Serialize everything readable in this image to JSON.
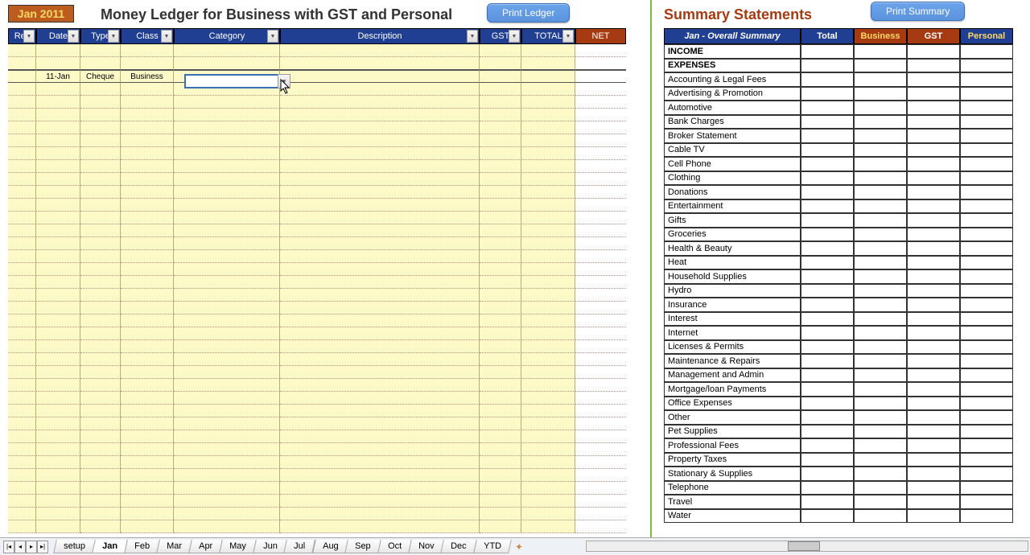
{
  "month_badge": "Jan  2011",
  "ledger_title": "Money Ledger for Business with GST and Personal",
  "summary_title": "Summary Statements",
  "buttons": {
    "print_ledger": "Print Ledger",
    "print_summary": "Print Summary"
  },
  "ledger_columns": {
    "rec": "Rec",
    "date": "Date",
    "type": "Type",
    "class": "Class",
    "category": "Category",
    "description": "Description",
    "gst": "GST",
    "total": "TOTAL",
    "net": "NET"
  },
  "ledger_row": {
    "date": "11-Jan",
    "type": "Cheque",
    "class": "Business"
  },
  "summary_columns": {
    "main": "Jan - Overall Summary",
    "total": "Total",
    "business": "Business",
    "gst": "GST",
    "personal": "Personal"
  },
  "summary_rows": [
    {
      "label": "INCOME",
      "head": true
    },
    {
      "label": "EXPENSES",
      "head": true
    },
    {
      "label": "Accounting & Legal Fees"
    },
    {
      "label": "Advertising & Promotion"
    },
    {
      "label": "Automotive"
    },
    {
      "label": "Bank Charges"
    },
    {
      "label": "Broker Statement"
    },
    {
      "label": "Cable TV"
    },
    {
      "label": "Cell Phone"
    },
    {
      "label": "Clothing"
    },
    {
      "label": "Donations"
    },
    {
      "label": "Entertainment"
    },
    {
      "label": "Gifts"
    },
    {
      "label": "Groceries"
    },
    {
      "label": "Health & Beauty"
    },
    {
      "label": "Heat"
    },
    {
      "label": "Household Supplies"
    },
    {
      "label": "Hydro"
    },
    {
      "label": "Insurance"
    },
    {
      "label": "Interest"
    },
    {
      "label": "Internet"
    },
    {
      "label": "Licenses & Permits"
    },
    {
      "label": "Maintenance & Repairs"
    },
    {
      "label": "Management and Admin"
    },
    {
      "label": "Mortgage/loan Payments"
    },
    {
      "label": "Office Expenses"
    },
    {
      "label": "Other"
    },
    {
      "label": "Pet Supplies"
    },
    {
      "label": "Professional Fees"
    },
    {
      "label": "Property Taxes"
    },
    {
      "label": "Stationary & Supplies"
    },
    {
      "label": "Telephone"
    },
    {
      "label": "Travel"
    },
    {
      "label": "Water"
    }
  ],
  "tabs": [
    "setup",
    "Jan",
    "Feb",
    "Mar",
    "Apr",
    "May",
    "Jun",
    "Jul",
    "Aug",
    "Sep",
    "Oct",
    "Nov",
    "Dec",
    "YTD"
  ],
  "active_tab": "Jan"
}
